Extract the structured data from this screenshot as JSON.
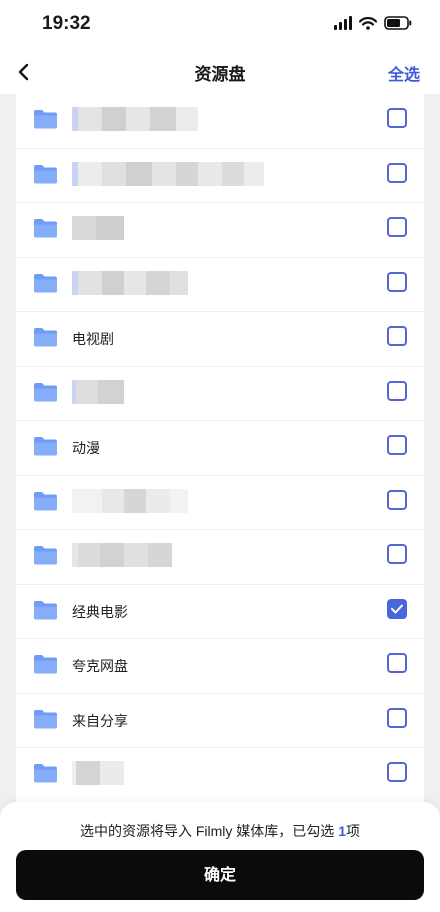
{
  "status_bar": {
    "time": "19:32",
    "icons": [
      "signal-icon",
      "wifi-icon",
      "battery-icon"
    ]
  },
  "nav": {
    "back_icon": "chevron-left-icon",
    "title": "资源盘",
    "select_all": "全选"
  },
  "folders": [
    {
      "name": "",
      "redacted": true,
      "checked": false
    },
    {
      "name": "",
      "redacted": true,
      "checked": false
    },
    {
      "name": "",
      "redacted": true,
      "checked": false
    },
    {
      "name": "",
      "redacted": true,
      "checked": false
    },
    {
      "name": "电视剧",
      "redacted": false,
      "checked": false
    },
    {
      "name": "",
      "redacted": true,
      "checked": false
    },
    {
      "name": "动漫",
      "redacted": false,
      "checked": false
    },
    {
      "name": "",
      "redacted": true,
      "checked": false
    },
    {
      "name": "",
      "redacted": true,
      "checked": false
    },
    {
      "name": "经典电影",
      "redacted": false,
      "checked": true
    },
    {
      "name": "夸克网盘",
      "redacted": false,
      "checked": false
    },
    {
      "name": "来自分享",
      "redacted": false,
      "checked": false
    },
    {
      "name": "",
      "redacted": true,
      "checked": false
    }
  ],
  "footer": {
    "note_prefix": "选中的资源将导入 Filmly 媒体库，已勾选",
    "selected_count": "1",
    "note_suffix": "项",
    "confirm_label": "确定"
  },
  "colors": {
    "accent": "#3b5bdb",
    "folder": "#6f9cf6",
    "confirm_bg": "#0b0b0c"
  }
}
